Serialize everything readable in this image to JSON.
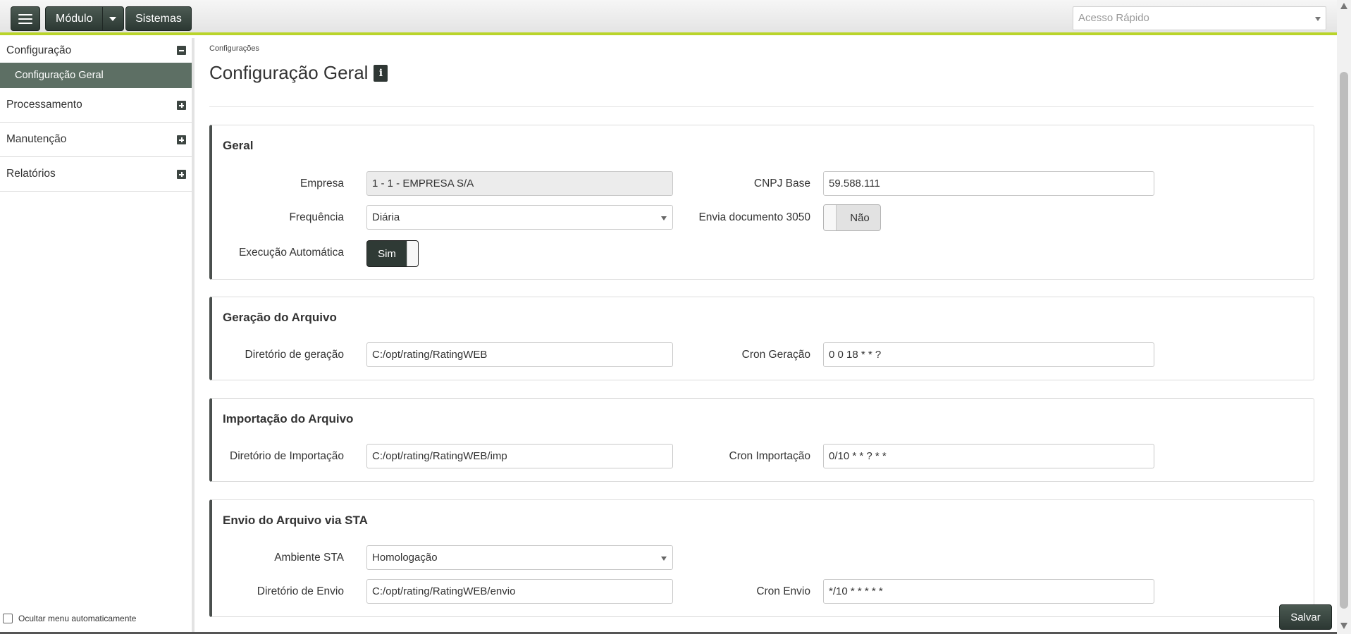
{
  "topbar": {
    "modulo_label": "Módulo",
    "sistemas_label": "Sistemas",
    "quick_access_placeholder": "Acesso Rápido"
  },
  "sidebar": {
    "items": [
      {
        "label": "Configuração",
        "state": "expanded"
      },
      {
        "label": "Processamento",
        "state": "collapsed"
      },
      {
        "label": "Manutenção",
        "state": "collapsed"
      },
      {
        "label": "Relatórios",
        "state": "collapsed"
      }
    ],
    "active_subitem": "Configuração Geral",
    "hide_menu_label": "Ocultar menu automaticamente"
  },
  "breadcrumb": "Configurações",
  "page_title": "Configuração Geral",
  "panels": {
    "geral": {
      "title": "Geral",
      "empresa_label": "Empresa",
      "empresa_value": "1 - 1 - EMPRESA S/A",
      "cnpj_label": "CNPJ Base",
      "cnpj_value": "59.588.111",
      "frequencia_label": "Frequência",
      "frequencia_value": "Diária",
      "envia_label": "Envia documento 3050",
      "envia_value": "Não",
      "execucao_label": "Execução Automática",
      "execucao_value": "Sim"
    },
    "geracao": {
      "title": "Geração do Arquivo",
      "dir_label": "Diretório de geração",
      "dir_value": "C:/opt/rating/RatingWEB",
      "cron_label": "Cron Geração",
      "cron_value": "0 0 18 * * ?"
    },
    "importacao": {
      "title": "Importação do Arquivo",
      "dir_label": "Diretório de Importação",
      "dir_value": "C:/opt/rating/RatingWEB/imp",
      "cron_label": "Cron Importação",
      "cron_value": "0/10 * * ? * *"
    },
    "envio": {
      "title": "Envio do Arquivo via STA",
      "ambiente_label": "Ambiente STA",
      "ambiente_value": "Homologação",
      "dir_label": "Diretório de Envio",
      "dir_value": "C:/opt/rating/RatingWEB/envio",
      "cron_label": "Cron Envio",
      "cron_value": "*/10 * * * * *"
    }
  },
  "save_label": "Salvar",
  "colors": {
    "accent": "#b9d42a",
    "dark_button": "#2c3833",
    "active_menu": "#5d6f64"
  }
}
